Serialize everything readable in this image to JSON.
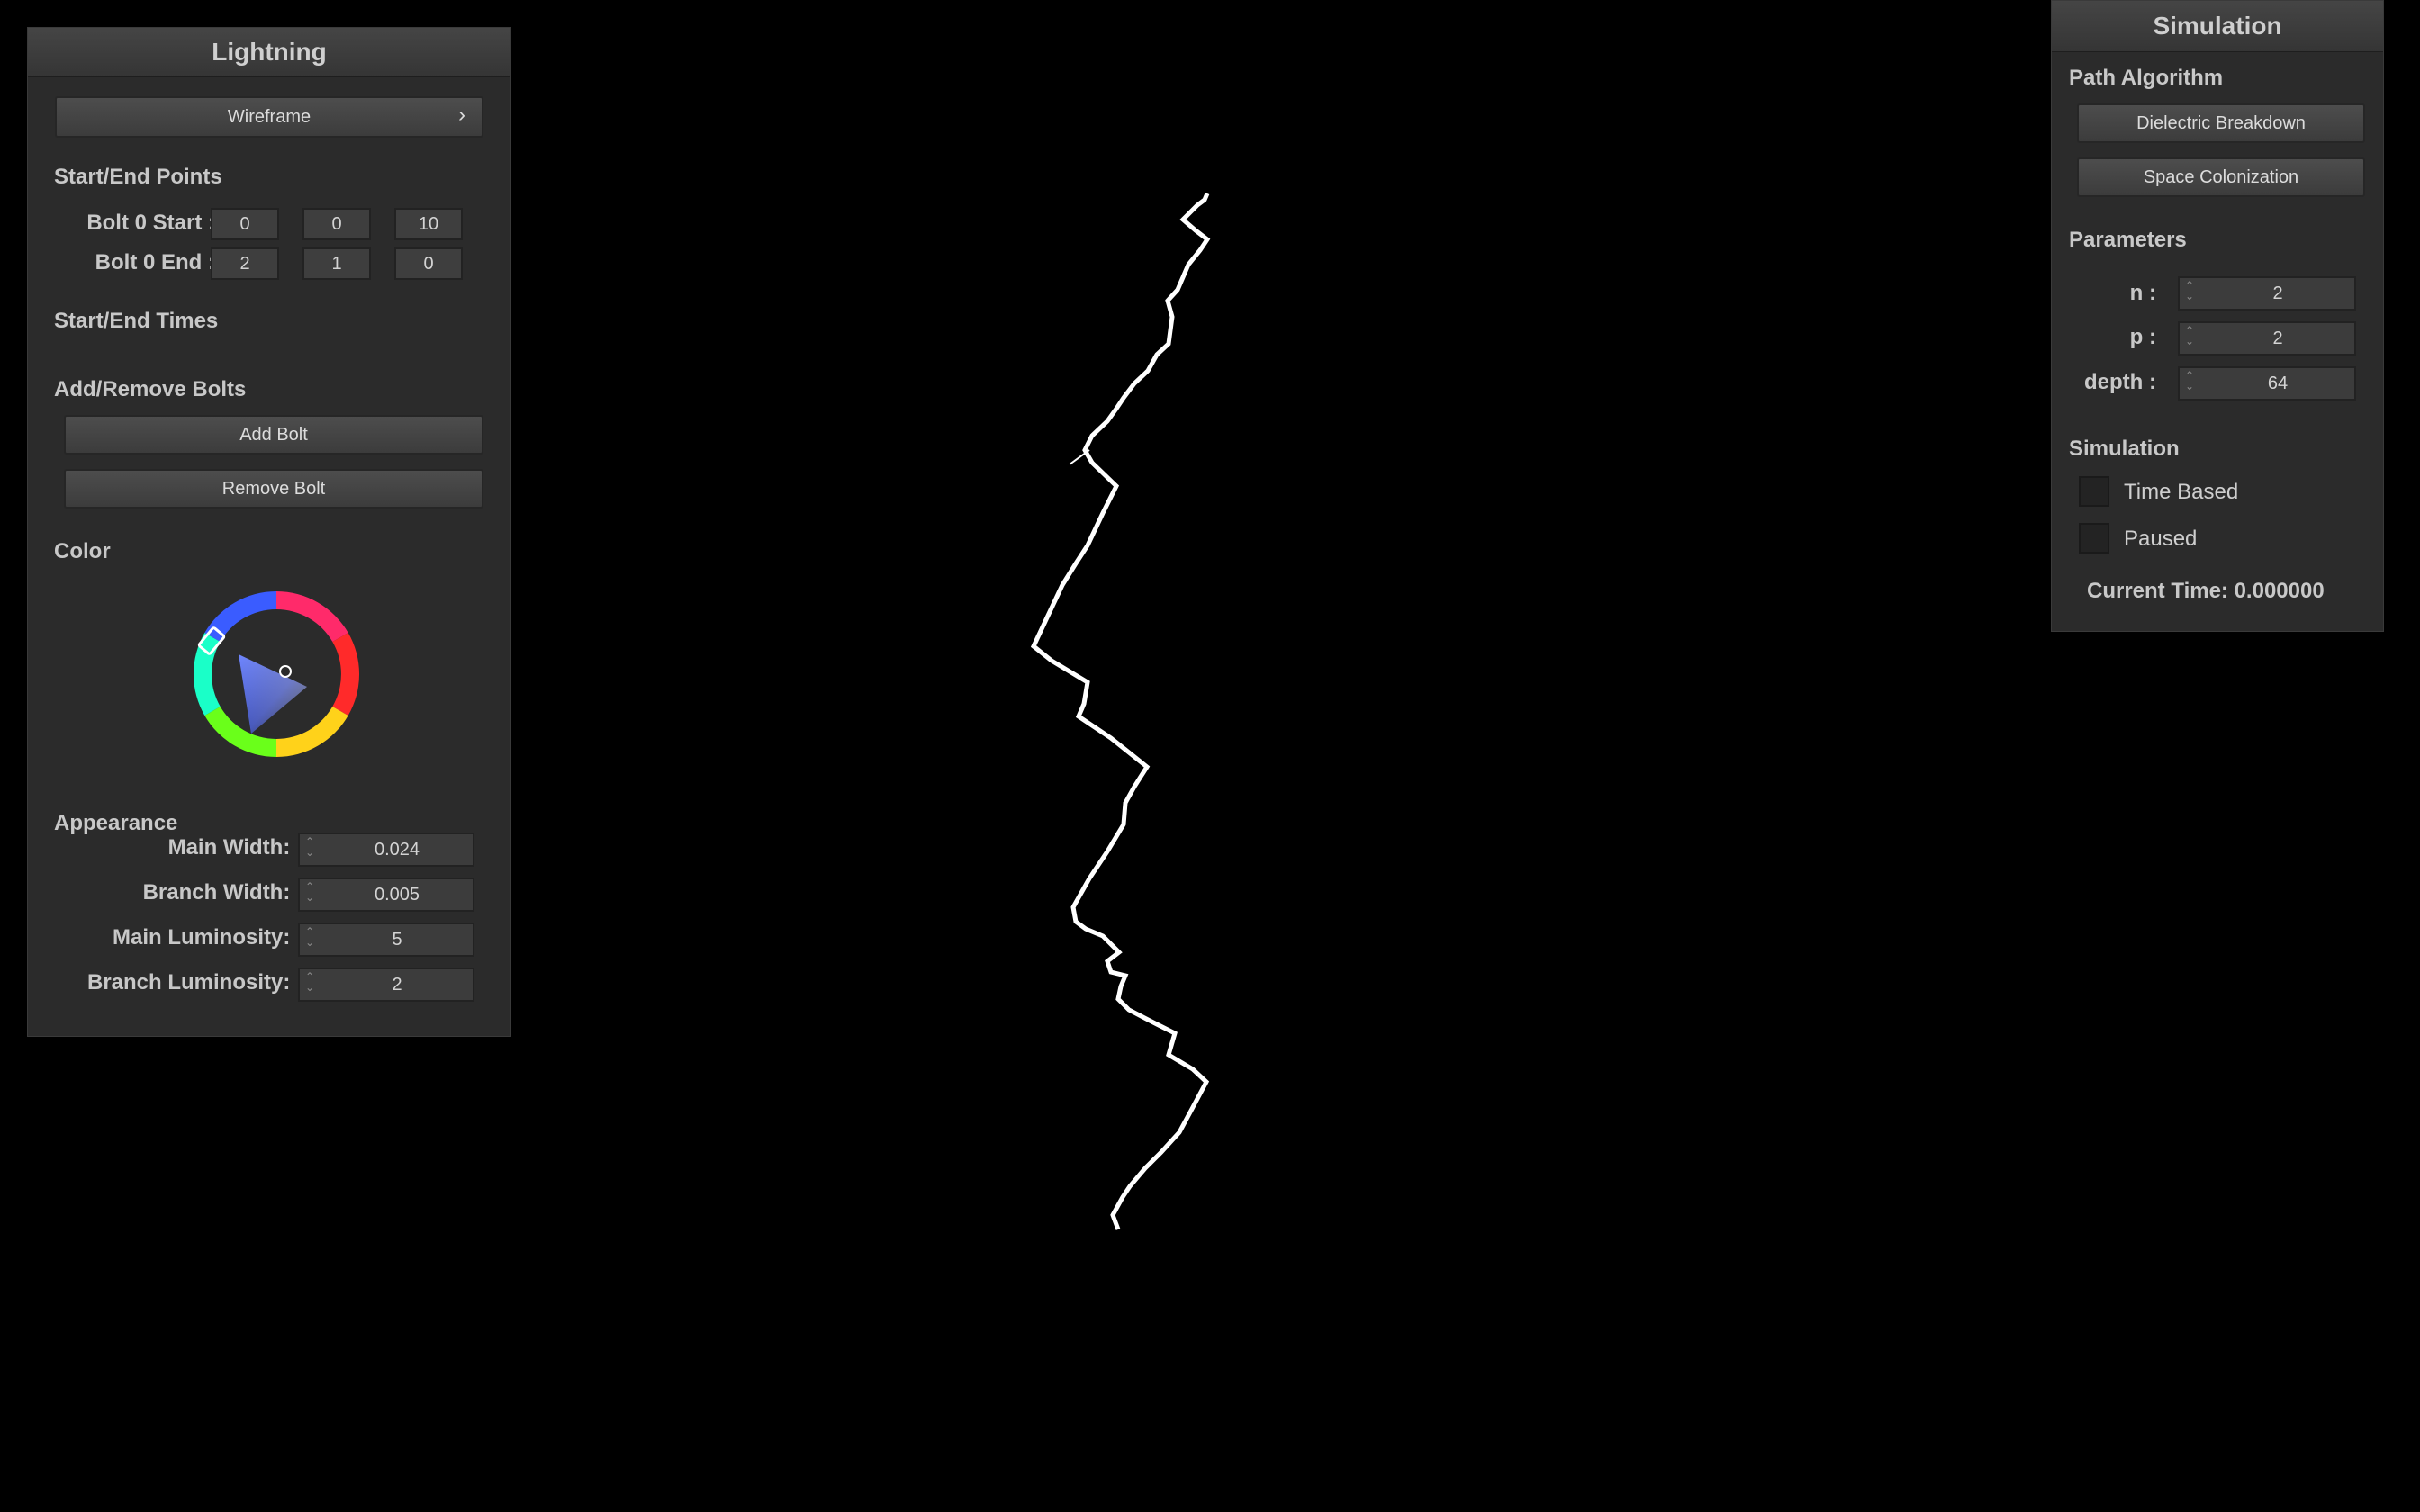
{
  "lightning_panel": {
    "title": "Lightning",
    "mode_button": "Wireframe",
    "mode_chevron": "›",
    "start_end_points_heading": "Start/End Points",
    "bolt_start_label": "Bolt 0 Start :",
    "bolt_start_values": [
      "0",
      "0",
      "10"
    ],
    "bolt_end_label": "Bolt 0 End :",
    "bolt_end_values": [
      "2",
      "1",
      "0"
    ],
    "start_end_times_heading": "Start/End Times",
    "add_remove_heading": "Add/Remove Bolts",
    "add_bolt_label": "Add Bolt",
    "remove_bolt_label": "Remove Bolt",
    "color_heading": "Color",
    "color_picker_icon": "hue-wheel-triangle",
    "selected_color": "#5a6fd0",
    "appearance_heading": "Appearance",
    "main_width_label": "Main Width: :",
    "main_width_value": "0.024",
    "branch_width_label": "Branch Width: :",
    "branch_width_value": "0.005",
    "main_lum_label": "Main Luminosity: :",
    "main_lum_value": "5",
    "branch_lum_label": "Branch Luminosity: :",
    "branch_lum_value": "2"
  },
  "simulation_panel": {
    "title": "Simulation",
    "path_algorithm_heading": "Path Algorithm",
    "dielectric_label": "Dielectric Breakdown",
    "space_colonization_label": "Space Colonization",
    "parameters_heading": "Parameters",
    "n_label": "n :",
    "n_value": "2",
    "p_label": "p :",
    "p_value": "2",
    "depth_label": "depth :",
    "depth_value": "64",
    "simulation_heading": "Simulation",
    "time_based_label": "Time Based",
    "time_based_checked": false,
    "paused_label": "Paused",
    "paused_checked": false,
    "current_time_label": "Current Time: 0.000000"
  },
  "viewport": {
    "bolt_color": "#ffffff",
    "background_color": "#000000"
  }
}
